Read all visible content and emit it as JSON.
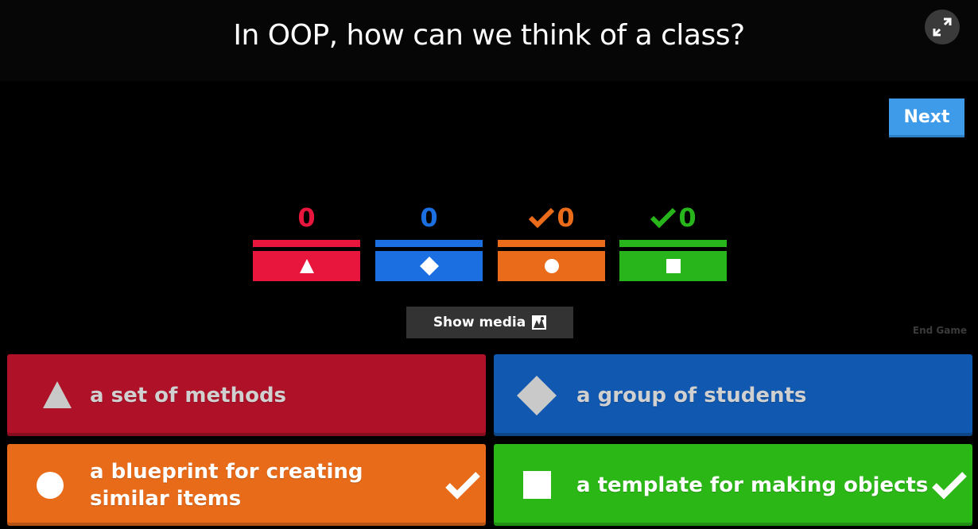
{
  "header": {
    "question": "In OOP, how can we think of a class?",
    "fullscreen_icon": "expand-icon"
  },
  "controls": {
    "next_label": "Next",
    "show_media_label": "Show media",
    "show_media_icon": "image-icon",
    "end_game_label": "End Game"
  },
  "results": [
    {
      "count": "0",
      "shape": "triangle",
      "color": "#e8163c",
      "correct": false
    },
    {
      "count": "0",
      "shape": "diamond",
      "color": "#1b6fe0",
      "correct": false
    },
    {
      "count": "0",
      "shape": "circle",
      "color": "#ea6c1a",
      "correct": true
    },
    {
      "count": "0",
      "shape": "square",
      "color": "#27b51b",
      "correct": true
    }
  ],
  "answers": [
    {
      "text": "a set of methods",
      "shape": "triangle",
      "color": "#af1128",
      "correct": false
    },
    {
      "text": "a group of students",
      "shape": "diamond",
      "color": "#1159b0",
      "correct": false
    },
    {
      "text": "a blueprint for creating similar items",
      "shape": "circle",
      "color": "#e86b1a",
      "correct": true
    },
    {
      "text": "a template for making objects",
      "shape": "square",
      "color": "#2bb816",
      "correct": true
    }
  ]
}
